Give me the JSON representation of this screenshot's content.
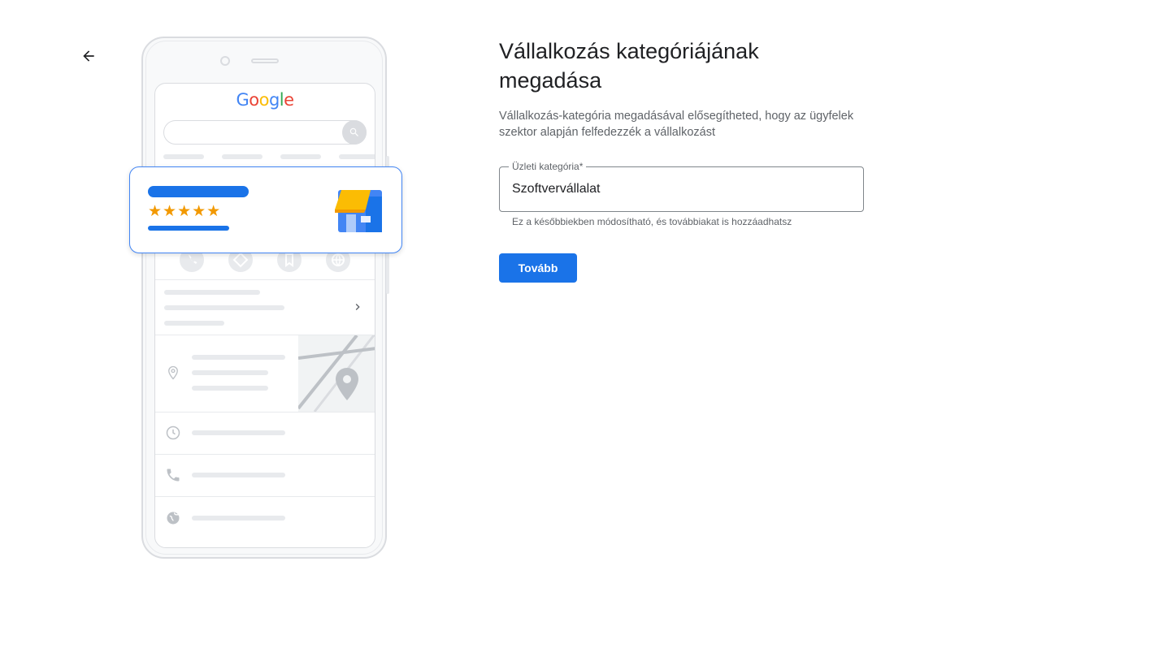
{
  "nav": {
    "back_icon": "arrow-back-icon"
  },
  "illustration": {
    "logo_letters": [
      {
        "char": "G",
        "color": "#4285f4"
      },
      {
        "char": "o",
        "color": "#ea4335"
      },
      {
        "char": "o",
        "color": "#fbbc05"
      },
      {
        "char": "g",
        "color": "#4285f4"
      },
      {
        "char": "l",
        "color": "#34a853"
      },
      {
        "char": "e",
        "color": "#ea4335"
      }
    ],
    "card_stars": "★★★★★",
    "rating_stars": 5,
    "icons": [
      "search-icon",
      "phone-icon",
      "directions-icon",
      "bookmark-icon",
      "globe-icon",
      "chevron-right-icon",
      "location-pin-icon",
      "clock-icon",
      "storefront-icon",
      "map-pin-icon"
    ]
  },
  "form": {
    "title": "Vállalkozás kategóriájának megadása",
    "subtitle": "Vállalkozás-kategória megadásával elősegítheted, hogy az ügyfelek szektor alapján felfedezzék a vállalkozást",
    "field_label": "Üzleti kategória*",
    "field_value": "Szoftvervállalat",
    "helper_text": "Ez a későbbiekben módosítható, és továbbiakat is hozzáadhatsz",
    "next_label": "Tovább"
  },
  "colors": {
    "primary": "#1a73e8",
    "star": "#f29900",
    "store_awning": "#fbbc04",
    "store_body": "#4285f4"
  }
}
